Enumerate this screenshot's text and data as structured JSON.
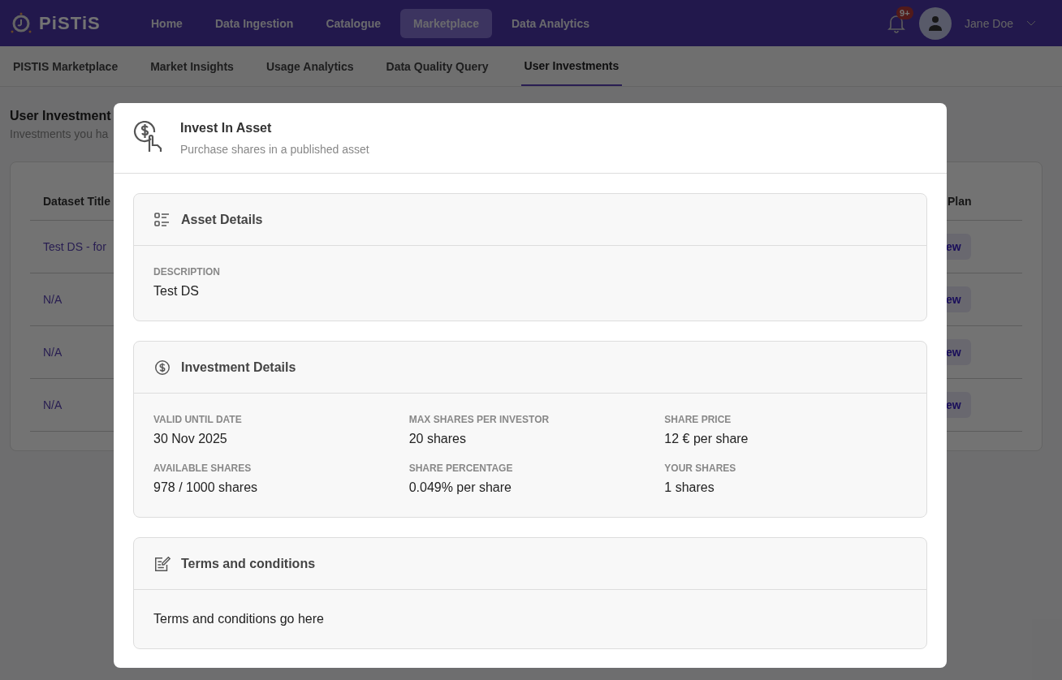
{
  "navbar": {
    "logo": "PiSTiS",
    "links": [
      {
        "label": "Home",
        "selected": false
      },
      {
        "label": "Data Ingestion",
        "selected": false
      },
      {
        "label": "Catalogue",
        "selected": false
      },
      {
        "label": "Marketplace",
        "selected": true
      },
      {
        "label": "Data Analytics",
        "selected": false
      }
    ],
    "notifications_badge": "9+",
    "user_name": "Jane Doe"
  },
  "subnav": [
    {
      "label": "PISTIS Marketplace",
      "selected": false
    },
    {
      "label": "Market Insights",
      "selected": false
    },
    {
      "label": "Usage Analytics",
      "selected": false
    },
    {
      "label": "Data Quality Query",
      "selected": false
    },
    {
      "label": "User Investments",
      "selected": true
    }
  ],
  "page": {
    "title": "User Investment",
    "subtitle": "Investments you ha",
    "table": {
      "column_1": "Dataset Title",
      "column_last": "Plan",
      "rows": [
        {
          "title": "Test DS - for",
          "action": "ew"
        },
        {
          "title": "N/A",
          "action": "ew"
        },
        {
          "title": "N/A",
          "action": "ew"
        },
        {
          "title": "N/A",
          "action": "ew"
        }
      ]
    }
  },
  "modal": {
    "title": "Invest In Asset",
    "subtitle": "Purchase shares in a published asset",
    "sections": [
      {
        "kind": "fields",
        "title": "Asset Details",
        "fields": [
          {
            "label": "DESCRIPTION",
            "value": "Test DS"
          }
        ]
      },
      {
        "kind": "fields",
        "title": "Investment Details",
        "fields": [
          {
            "label": "VALID UNTIL DATE",
            "value": "30 Nov 2025"
          },
          {
            "label": "MAX SHARES PER INVESTOR",
            "value": "20 shares"
          },
          {
            "label": "SHARE PRICE",
            "value": "12 € per share"
          },
          {
            "label": "AVAILABLE SHARES",
            "value": "978 / 1000 shares"
          },
          {
            "label": "SHARE PERCENTAGE",
            "value": "0.049% per share"
          },
          {
            "label": "YOUR SHARES",
            "value": "1 shares"
          }
        ]
      },
      {
        "kind": "text",
        "title": "Terms and conditions",
        "text": "Terms and conditions go here"
      }
    ]
  }
}
